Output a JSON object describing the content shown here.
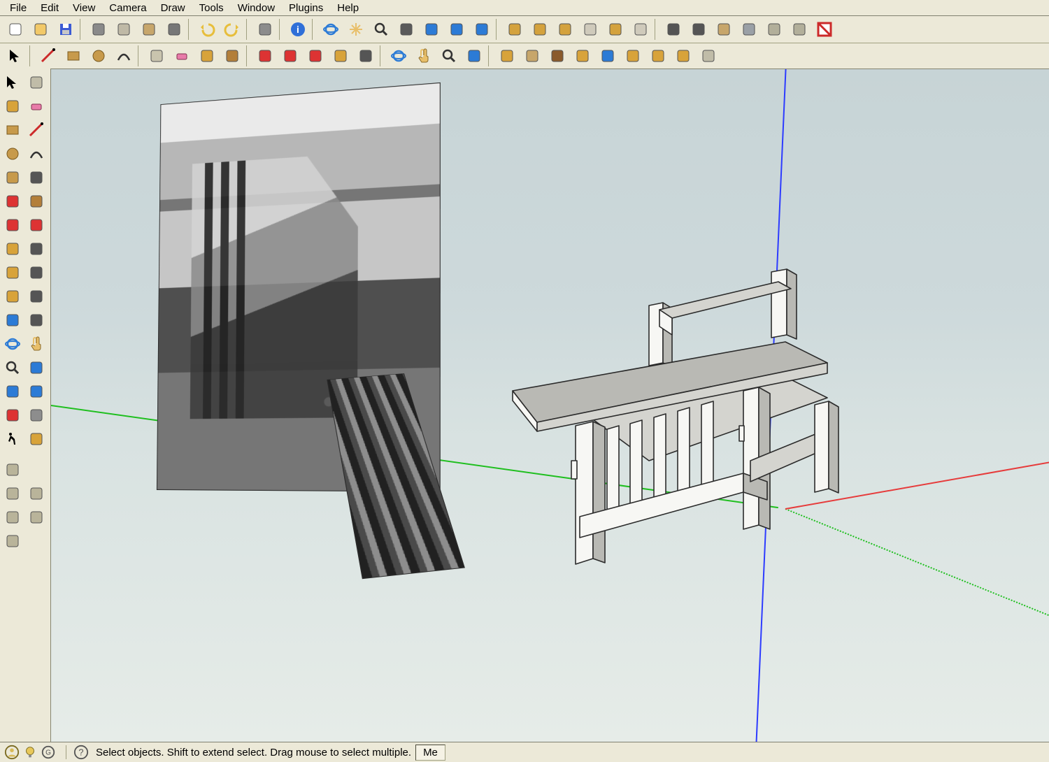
{
  "menu": {
    "items": [
      "File",
      "Edit",
      "View",
      "Camera",
      "Draw",
      "Tools",
      "Window",
      "Plugins",
      "Help"
    ]
  },
  "toolbar1": {
    "groups": [
      [
        "new-file-icon",
        "open-file-icon",
        "save-file-icon"
      ],
      [
        "cut-icon",
        "copy-icon",
        "paste-icon",
        "delete-icon"
      ],
      [
        "undo-icon",
        "redo-icon"
      ],
      [
        "print-icon"
      ],
      [
        "model-info-icon"
      ],
      [
        "orbit-icon",
        "pan-icon",
        "zoom-icon",
        "zoom-window-icon",
        "zoom-extents-icon",
        "previous-view-icon",
        "next-view-icon"
      ],
      [
        "iso-view-icon",
        "top-view-icon",
        "front-view-icon",
        "right-view-icon",
        "back-view-icon",
        "left-view-icon"
      ],
      [
        "standard-views-icon",
        "face-style-icon",
        "shadow-settings-icon",
        "xray-icon",
        "view-axes-icon",
        "view-guides-icon",
        "view-section-icon"
      ]
    ]
  },
  "toolbar2": {
    "groups": [
      [
        "select-tool-icon"
      ],
      [
        "line-tool-icon",
        "rectangle-tool-icon",
        "circle-tool-icon",
        "arc-tool-icon"
      ],
      [
        "make-component-icon",
        "eraser-tool-icon",
        "paint-bucket-icon",
        "push-pull-icon"
      ],
      [
        "move-tool-icon",
        "rotate-tool-icon",
        "follow-me-icon",
        "scale-tool-icon",
        "offset-tool-icon"
      ],
      [
        "orbit-tool-icon",
        "pan-tool-icon",
        "zoom-tool-icon",
        "zoom-extents-tool-icon"
      ],
      [
        "add-location-icon",
        "toggle-terrain-icon",
        "share-model-icon",
        "place-component-icon",
        "get-models-icon",
        "3d-warehouse-icon",
        "export-icon",
        "upload-icon",
        "layer-icon"
      ]
    ]
  },
  "leftPalette": {
    "rows": [
      [
        "select-icon",
        "lasso-icon"
      ],
      [
        "paint-icon",
        "eraser-icon"
      ],
      [
        "rectangle-icon",
        "line-icon"
      ],
      [
        "circle2-icon",
        "arc2-icon"
      ],
      [
        "polygon-icon",
        "freehand-icon"
      ],
      [
        "move2-icon",
        "pushpull2-icon"
      ],
      [
        "rotate2-icon",
        "followme2-icon"
      ],
      [
        "scale2-icon",
        "offset2-icon"
      ],
      [
        "tape-icon",
        "dimension-icon"
      ],
      [
        "protractor-icon",
        "text-label-icon"
      ],
      [
        "axes-icon",
        "3dtext-icon"
      ],
      [
        "orbit2-icon",
        "pan2-icon"
      ],
      [
        "zoom2-icon",
        "zoomextents2-icon"
      ],
      [
        "previous2-icon",
        "next2-icon"
      ],
      [
        "position-camera-icon",
        "look-around-icon"
      ],
      [
        "walk-icon",
        "section-plane-icon"
      ]
    ],
    "rows2": [
      [
        "outliner-icon"
      ],
      [
        "layers1-icon",
        "layers2-icon"
      ],
      [
        "scenes1-icon",
        "scenes2-icon"
      ],
      [
        "softedges-icon"
      ]
    ]
  },
  "status": {
    "hint": "Select objects. Shift to extend select. Drag mouse to select multiple.",
    "right_label": "Me"
  },
  "icon_colors": {
    "new-file-icon": "#ffffff",
    "open-file-icon": "#f2c968",
    "save-file-icon": "#3c5bd4",
    "cut-icon": "#8a8a8a",
    "copy-icon": "#bfb9a6",
    "paste-icon": "#c7a66b",
    "delete-icon": "#777",
    "undo-icon": "#e7be3b",
    "redo-icon": "#e7be3b",
    "print-icon": "#8c8c8c",
    "model-info-icon": "#2f6fd8",
    "orbit-icon": "#2c7bd6",
    "pan-icon": "#e8bf6a",
    "zoom-icon": "#5a5a5a",
    "zoom-window-icon": "#5a5a5a",
    "zoom-extents-icon": "#2c7bd6",
    "previous-view-icon": "#2c7bd6",
    "next-view-icon": "#2c7bd6",
    "iso-view-icon": "#d4a23d",
    "top-view-icon": "#d4a23d",
    "front-view-icon": "#d4a23d",
    "right-view-icon": "#cfcabb",
    "back-view-icon": "#d4a23d",
    "left-view-icon": "#cfcabb",
    "standard-views-icon": "#555",
    "face-style-icon": "#555",
    "shadow-settings-icon": "#c7a66b",
    "xray-icon": "#9aa0a6",
    "view-axes-icon": "#b2af9a",
    "view-guides-icon": "#b2af9a",
    "view-section-icon": "#cc2a2a",
    "select-tool-icon": "#000",
    "line-tool-icon": "#cc2a2a",
    "rectangle-tool-icon": "#c79a4b",
    "circle-tool-icon": "#c79a4b",
    "arc-tool-icon": "#555",
    "make-component-icon": "#c9c4ae",
    "eraser-tool-icon": "#e87ba9",
    "paint-bucket-icon": "#d8a33a",
    "push-pull-icon": "#b37f3a",
    "move-tool-icon": "#d33",
    "rotate-tool-icon": "#d33",
    "follow-me-icon": "#d33",
    "scale-tool-icon": "#d8a33a",
    "offset-tool-icon": "#555",
    "orbit-tool-icon": "#2c7bd6",
    "pan-tool-icon": "#e8bf6a",
    "zoom-tool-icon": "#5a5a5a",
    "zoom-extents-tool-icon": "#2c7bd6",
    "add-location-icon": "#d8a33a",
    "toggle-terrain-icon": "#c7a66b",
    "share-model-icon": "#8a5a2b",
    "place-component-icon": "#d8a33a",
    "get-models-icon": "#2c7bd6",
    "3d-warehouse-icon": "#d8a33a",
    "export-icon": "#d8a33a",
    "upload-icon": "#d8a33a",
    "layer-icon": "#c0bca8",
    "select-icon": "#000",
    "lasso-icon": "#c0bca8",
    "paint-icon": "#d8a33a",
    "eraser-icon": "#e87ba9",
    "rectangle-icon": "#c79a4b",
    "line-icon": "#cc2a2a",
    "circle2-icon": "#c79a4b",
    "arc2-icon": "#555",
    "polygon-icon": "#c79a4b",
    "freehand-icon": "#555",
    "move2-icon": "#d33",
    "pushpull2-icon": "#b37f3a",
    "rotate2-icon": "#d33",
    "followme2-icon": "#d33",
    "scale2-icon": "#d8a33a",
    "offset2-icon": "#555",
    "tape-icon": "#d8a33a",
    "dimension-icon": "#555",
    "protractor-icon": "#d8a33a",
    "text-label-icon": "#555",
    "axes-icon": "#2c7bd6",
    "3dtext-icon": "#555",
    "orbit2-icon": "#2c7bd6",
    "pan2-icon": "#e8bf6a",
    "zoom2-icon": "#5a5a5a",
    "zoomextents2-icon": "#2c7bd6",
    "previous2-icon": "#2c7bd6",
    "next2-icon": "#2c7bd6",
    "position-camera-icon": "#d33",
    "look-around-icon": "#8d8d8d",
    "walk-icon": "#000",
    "section-plane-icon": "#d8a33a",
    "outliner-icon": "#b9b49a",
    "layers1-icon": "#b9b49a",
    "layers2-icon": "#b9b49a",
    "scenes1-icon": "#b9b49a",
    "scenes2-icon": "#b9b49a",
    "softedges-icon": "#b9b49a"
  }
}
